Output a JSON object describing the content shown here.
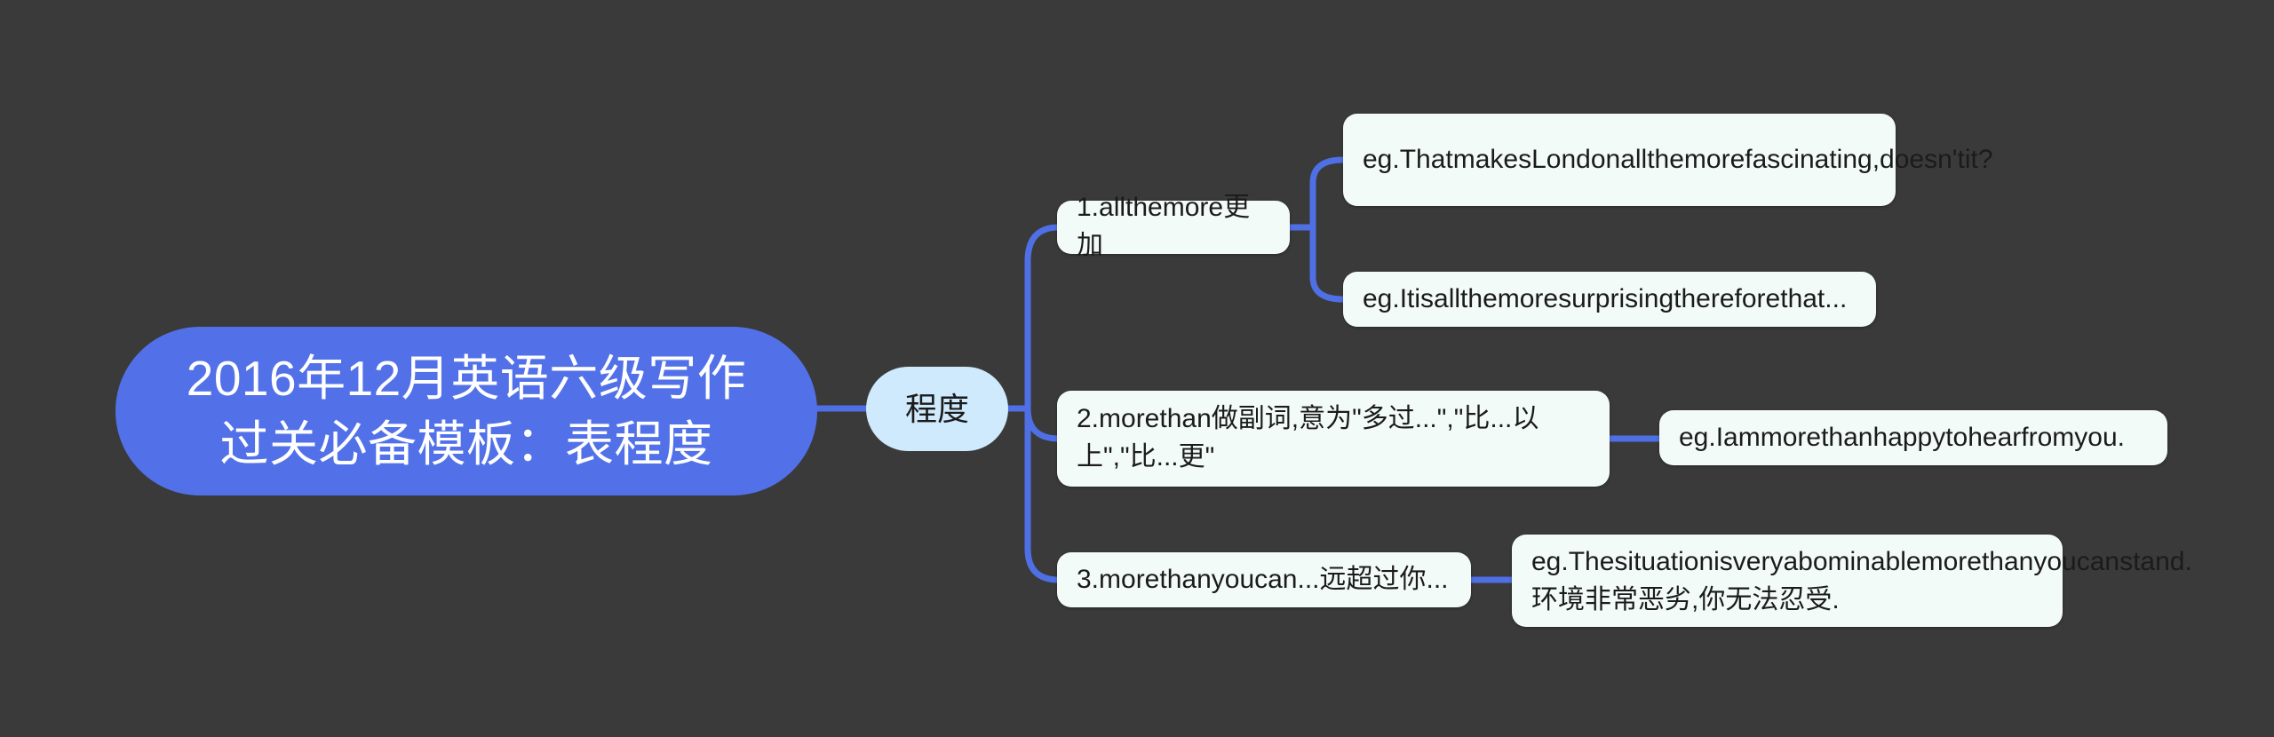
{
  "theme": {
    "background": "#3a3a3a",
    "root_fill": "#5271e8",
    "root_text": "#ffffff",
    "level1_fill": "#cfeafc",
    "node_fill": "#f3fbf9",
    "node_text": "#1b1b1b",
    "edge_color": "#4f6fe5"
  },
  "mindmap": {
    "root": {
      "id": "root",
      "text": "2016年12月英语六级写作过关必备模板：表程度",
      "line1": "2016年12月英语六级写作",
      "line2": "过关必备模板：表程度"
    },
    "level1": {
      "id": "chengdu",
      "text": "程度"
    },
    "branches": [
      {
        "id": "branch-1",
        "text": "1.allthemore更加",
        "children": [
          {
            "id": "leaf-1",
            "text": "eg.ThatmakesLondonallthemorefascinating,doesn'tit?"
          },
          {
            "id": "leaf-2",
            "text": "eg.Itisallthemoresurprisingthereforethat..."
          }
        ]
      },
      {
        "id": "branch-2",
        "text": "2.morethan做副词,意为\"多过...\",\"比...以上\",\"比...更\"",
        "children": [
          {
            "id": "leaf-3",
            "text": "eg.Iammorethanhappytohearfromyou."
          }
        ]
      },
      {
        "id": "branch-3",
        "text": "3.morethanyoucan...远超过你...",
        "children": [
          {
            "id": "leaf-4",
            "text": "eg.Thesituationisveryabominablemorethanyoucanstand.环境非常恶劣,你无法忍受."
          }
        ]
      }
    ]
  }
}
